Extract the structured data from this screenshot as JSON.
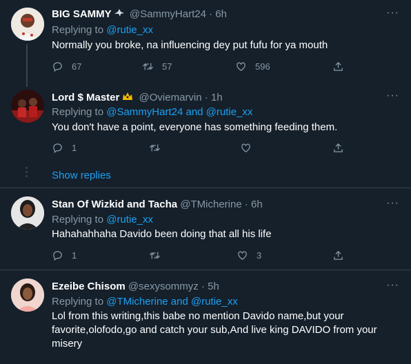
{
  "colors": {
    "background": "#15202b",
    "text": "#ffffff",
    "secondary": "#8899a6",
    "link": "#1da1f2",
    "border": "#38444d"
  },
  "tweets": [
    {
      "name": "BIG SAMMY",
      "badge_icon": "eagle-icon",
      "handle": "@SammyHart24",
      "sep": "·",
      "time": "6h",
      "replying_label": "Replying to",
      "reply_targets": "@rutie_xx",
      "text": "Normally you broke, na influencing dey put fufu for ya mouth",
      "reply_count": "67",
      "retweet_count": "57",
      "like_count": "596"
    },
    {
      "name": "Lord $ Master",
      "badge_icon": "crown-icon",
      "handle": "@Oviemarvin",
      "sep": "·",
      "time": "1h",
      "replying_label": "Replying to",
      "reply_targets": "@SammyHart24 and @rutie_xx",
      "text": "You don't have a point, everyone has something feeding them.",
      "reply_count": "1",
      "retweet_count": "",
      "like_count": ""
    },
    {
      "name": "Stan Of Wizkid and Tacha",
      "handle": "@TMicherine",
      "sep": "·",
      "time": "6h",
      "replying_label": "Replying to",
      "reply_targets": "@rutie_xx",
      "text": "Hahahahhaha Davido been   doing that all his life",
      "reply_count": "1",
      "retweet_count": "",
      "like_count": "3"
    },
    {
      "name": "Ezeibe Chisom",
      "handle": "@sexysommyz",
      "sep": "·",
      "time": "5h",
      "replying_label": "Replying to",
      "reply_targets": "@TMicherine and @rutie_xx",
      "text": "Lol from this writing,this babe no mention Davido name,but your favorite,olofodo,go and catch your sub,And live king DAVIDO from your misery"
    }
  ],
  "show_replies": "Show replies",
  "more_label": "···"
}
